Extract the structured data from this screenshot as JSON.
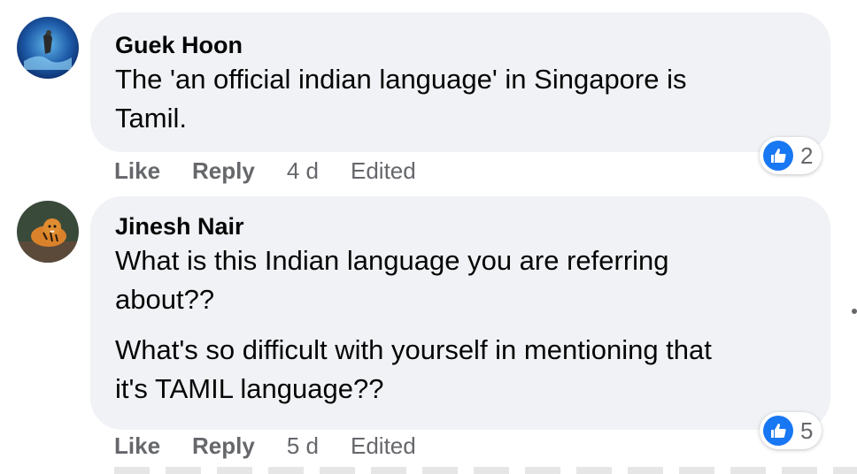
{
  "comments": [
    {
      "author": "Guek Hoon",
      "paragraphs": [
        "The 'an official indian language' in Singapore is",
        "Tamil."
      ],
      "actions": {
        "like": "Like",
        "reply": "Reply",
        "time": "4 d",
        "edited": "Edited"
      },
      "reaction_count": "2"
    },
    {
      "author": "Jinesh Nair",
      "paragraphs": [
        "What is this Indian language you are referring",
        "about??",
        "What's so difficult with yourself in mentioning that",
        "it's TAMIL language??"
      ],
      "actions": {
        "like": "Like",
        "reply": "Reply",
        "time": "5 d",
        "edited": "Edited"
      },
      "reaction_count": "5"
    }
  ],
  "colors": {
    "bubble": "#f0f2f5",
    "like_blue": "#1877f2",
    "meta_gray": "#65676b"
  }
}
